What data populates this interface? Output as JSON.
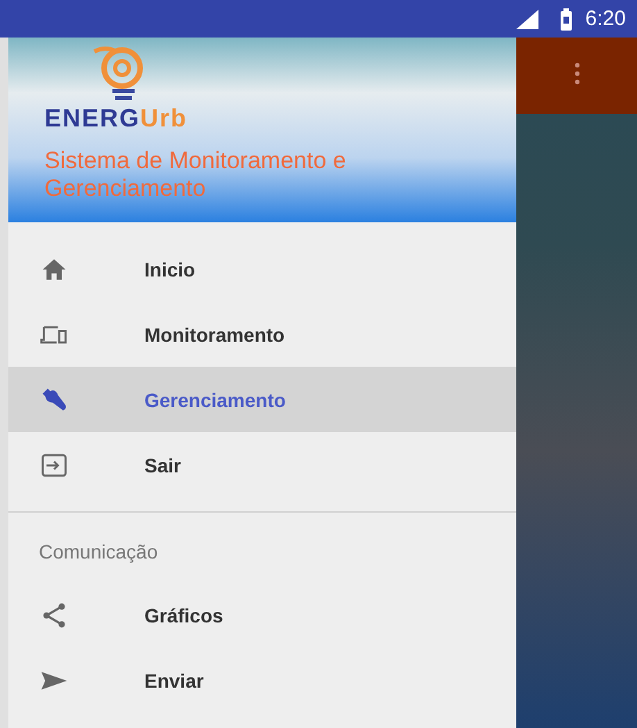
{
  "status_bar": {
    "time": "6:20"
  },
  "header": {
    "logo_main": "ENERG",
    "logo_accent": "Urb",
    "subtitle": "Sistema de Monitoramento e Gerenciamento"
  },
  "menu": [
    {
      "label": "Inicio",
      "selected": false
    },
    {
      "label": "Monitoramento",
      "selected": false
    },
    {
      "label": "Gerenciamento",
      "selected": true
    },
    {
      "label": "Sair",
      "selected": false
    }
  ],
  "section": {
    "title": "Comunicação",
    "items": [
      {
        "label": "Gráficos"
      },
      {
        "label": "Enviar"
      }
    ]
  }
}
